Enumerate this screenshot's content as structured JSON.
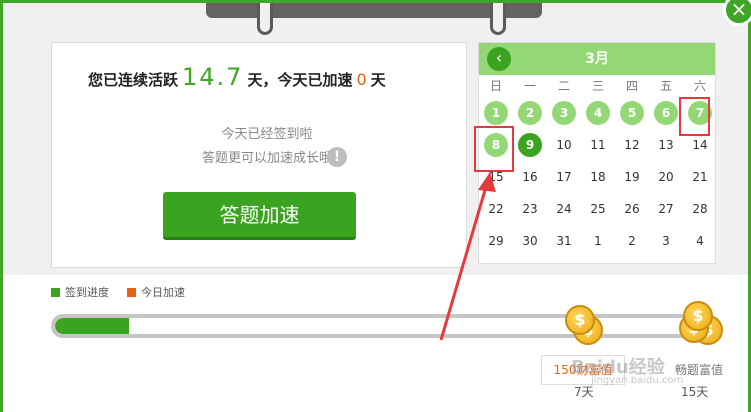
{
  "streak": {
    "prefix": "您已连续活跃",
    "days_active": "14.7",
    "unit_days": "天，",
    "middle": "今天已加速",
    "accel_days": "0",
    "suffix": "天"
  },
  "messages": {
    "signed_today": "今天已经签到啦",
    "quiz_hint": "答题更可以加速成长哦",
    "info_icon": "!"
  },
  "quiz_button": {
    "label": "答题加速"
  },
  "calendar": {
    "month": "3月",
    "prev_label": "‹",
    "weekdays": [
      "日",
      "一",
      "二",
      "三",
      "四",
      "五",
      "六"
    ],
    "days": [
      {
        "label": "1",
        "state": "signed"
      },
      {
        "label": "2",
        "state": "signed"
      },
      {
        "label": "3",
        "state": "signed"
      },
      {
        "label": "4",
        "state": "signed"
      },
      {
        "label": "5",
        "state": "signed"
      },
      {
        "label": "6",
        "state": "signed"
      },
      {
        "label": "7",
        "state": "signed"
      },
      {
        "label": "8",
        "state": "signed"
      },
      {
        "label": "9",
        "state": "today"
      },
      {
        "label": "10",
        "state": ""
      },
      {
        "label": "11",
        "state": ""
      },
      {
        "label": "12",
        "state": ""
      },
      {
        "label": "13",
        "state": ""
      },
      {
        "label": "14",
        "state": ""
      },
      {
        "label": "15",
        "state": ""
      },
      {
        "label": "16",
        "state": ""
      },
      {
        "label": "17",
        "state": ""
      },
      {
        "label": "18",
        "state": ""
      },
      {
        "label": "19",
        "state": ""
      },
      {
        "label": "20",
        "state": ""
      },
      {
        "label": "21",
        "state": ""
      },
      {
        "label": "22",
        "state": ""
      },
      {
        "label": "23",
        "state": ""
      },
      {
        "label": "24",
        "state": ""
      },
      {
        "label": "25",
        "state": ""
      },
      {
        "label": "26",
        "state": ""
      },
      {
        "label": "27",
        "state": ""
      },
      {
        "label": "28",
        "state": ""
      },
      {
        "label": "29",
        "state": ""
      },
      {
        "label": "30",
        "state": ""
      },
      {
        "label": "31",
        "state": ""
      },
      {
        "label": "1",
        "state": ""
      },
      {
        "label": "2",
        "state": ""
      },
      {
        "label": "3",
        "state": ""
      },
      {
        "label": "4",
        "state": ""
      }
    ]
  },
  "legend": {
    "progress_label": "签到进度",
    "progress_color": "#3aa31f",
    "accel_label": "今日加速",
    "accel_color": "#e56212"
  },
  "progress": {
    "fill_fraction": 0.115
  },
  "rewards": {
    "coin_symbol": "$",
    "first_reward": "150财富值",
    "second_reward": "畅题富值",
    "first_day": "7天",
    "second_day": "15天"
  },
  "watermark": {
    "text": "Baidu经验",
    "url": "jingyan.baidu.com"
  },
  "close_icon": "×"
}
